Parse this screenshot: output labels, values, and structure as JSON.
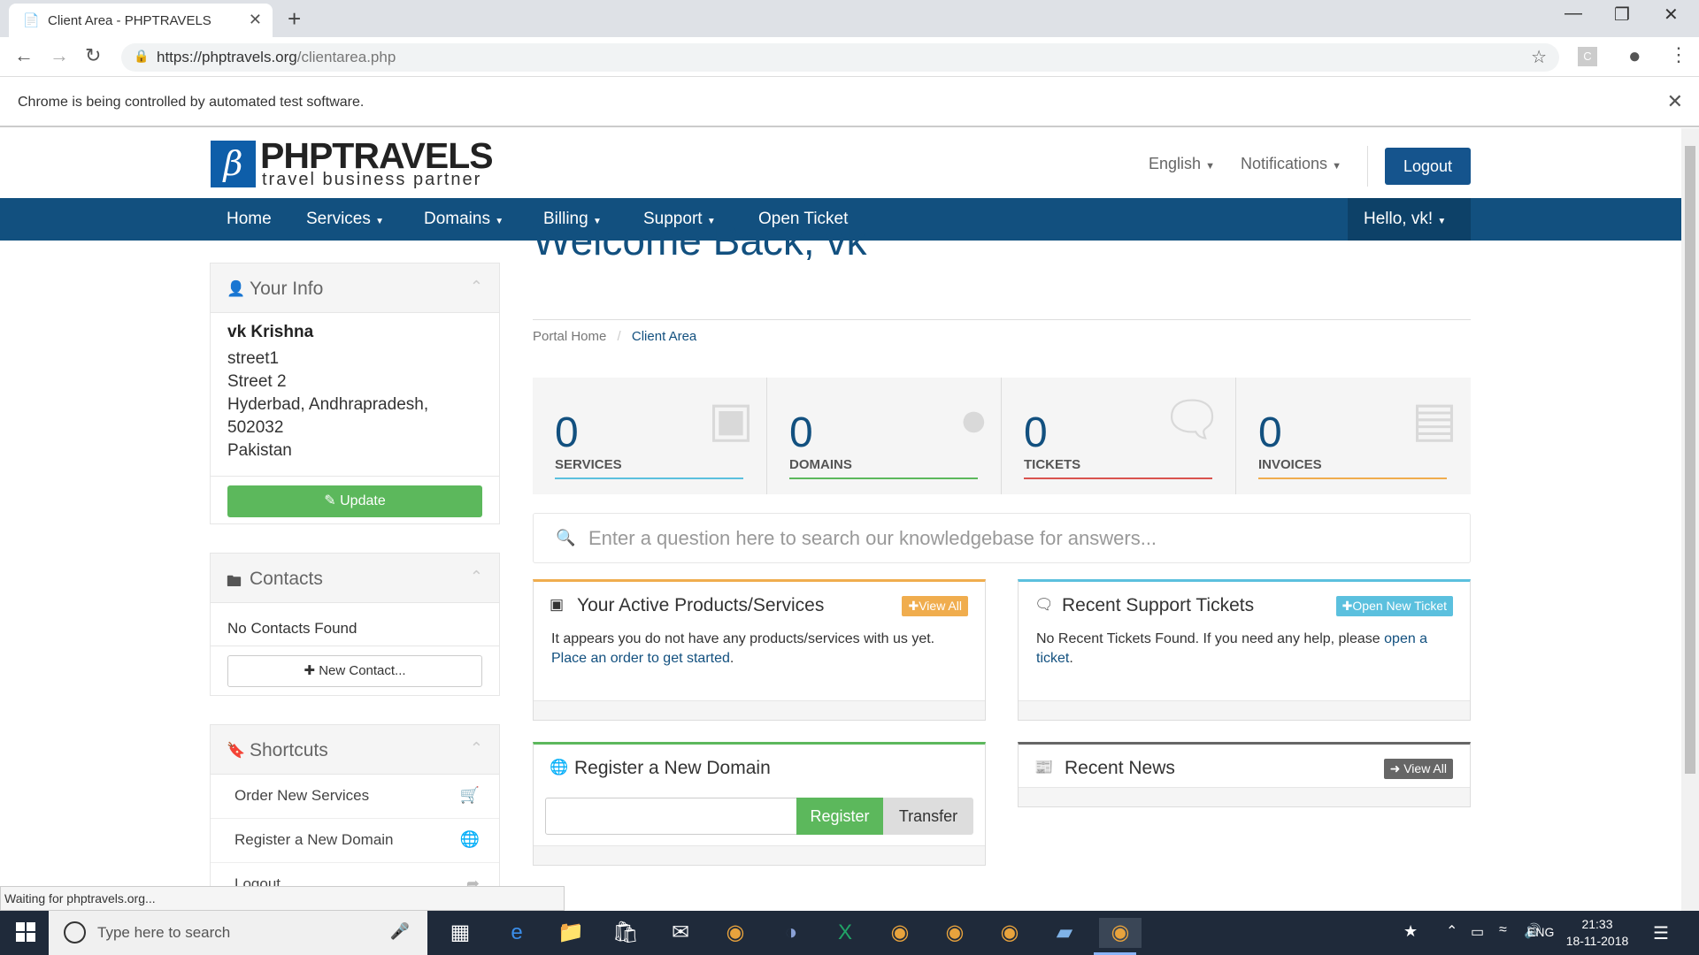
{
  "browser": {
    "tab_title": "Client Area - PHPTRAVELS",
    "url_host": "https://phptravels.org",
    "url_path": "/clientarea.php",
    "infobar_text": "Chrome is being controlled by automated test software.",
    "status_text": "Waiting for phptravels.org..."
  },
  "header": {
    "logo_main": "PHPTRAVELS",
    "logo_sub": "travel business partner",
    "language": "English",
    "notifications": "Notifications",
    "logout": "Logout"
  },
  "nav": {
    "items": [
      "Home",
      "Services",
      "Domains",
      "Billing",
      "Support",
      "Open Ticket"
    ],
    "hello": "Hello, vk!"
  },
  "sidebar": {
    "your_info": {
      "title": "Your Info",
      "name": "vk Krishna",
      "address_lines": [
        "street1",
        "Street 2",
        "Hyderbad, Andhrapradesh,",
        "502032",
        "Pakistan"
      ],
      "update_button": "Update"
    },
    "contacts": {
      "title": "Contacts",
      "empty_text": "No Contacts Found",
      "new_button": "New Contact..."
    },
    "shortcuts": {
      "title": "Shortcuts",
      "items": [
        "Order New Services",
        "Register a New Domain",
        "Logout"
      ]
    }
  },
  "main": {
    "welcome": "Welcome Back, vk",
    "breadcrumb": [
      "Portal Home",
      "Client Area"
    ],
    "stats": [
      {
        "value": "0",
        "label": "SERVICES",
        "color": "#5bc0de"
      },
      {
        "value": "0",
        "label": "DOMAINS",
        "color": "#5cb85c"
      },
      {
        "value": "0",
        "label": "TICKETS",
        "color": "#d9534f"
      },
      {
        "value": "0",
        "label": "INVOICES",
        "color": "#f0ad4e"
      }
    ],
    "kb_placeholder": "Enter a question here to search our knowledgebase for answers...",
    "products": {
      "title": "Your Active Products/Services",
      "badge": "View All",
      "text": "It appears you do not have any products/services with us yet.",
      "link": "Place an order to get started",
      "link_end": "."
    },
    "tickets": {
      "title": "Recent Support Tickets",
      "badge": "Open New Ticket",
      "text": "No Recent Tickets Found. If you need any help, please",
      "link": "open a ticket",
      "link_end": "."
    },
    "domain": {
      "title": "Register a New Domain",
      "register": "Register",
      "transfer": "Transfer"
    },
    "news": {
      "title": "Recent News",
      "badge": "View All"
    }
  },
  "taskbar": {
    "search_placeholder": "Type here to search",
    "lang": "ENG",
    "time": "21:33",
    "date": "18-11-2018"
  }
}
